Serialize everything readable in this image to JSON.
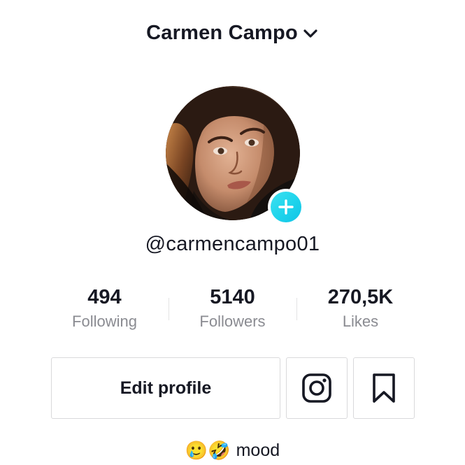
{
  "header": {
    "display_name": "Carmen Campo",
    "dropdown_icon": "chevron-down-icon"
  },
  "profile": {
    "avatar": "profile-photo",
    "add_icon": "plus-icon",
    "username": "@carmencampo01"
  },
  "stats": [
    {
      "value": "494",
      "label": "Following"
    },
    {
      "value": "5140",
      "label": "Followers"
    },
    {
      "value": "270,5K",
      "label": "Likes"
    }
  ],
  "actions": {
    "edit_profile_label": "Edit profile",
    "instagram_icon": "instagram-icon",
    "bookmark_icon": "bookmark-icon"
  },
  "bio": {
    "emoji_1": "🥲",
    "emoji_2": "🤣",
    "text": "mood"
  },
  "colors": {
    "text": "#161823",
    "secondary_text": "#8a8b91",
    "accent": "#20d5ec",
    "border": "#d9d9db"
  }
}
